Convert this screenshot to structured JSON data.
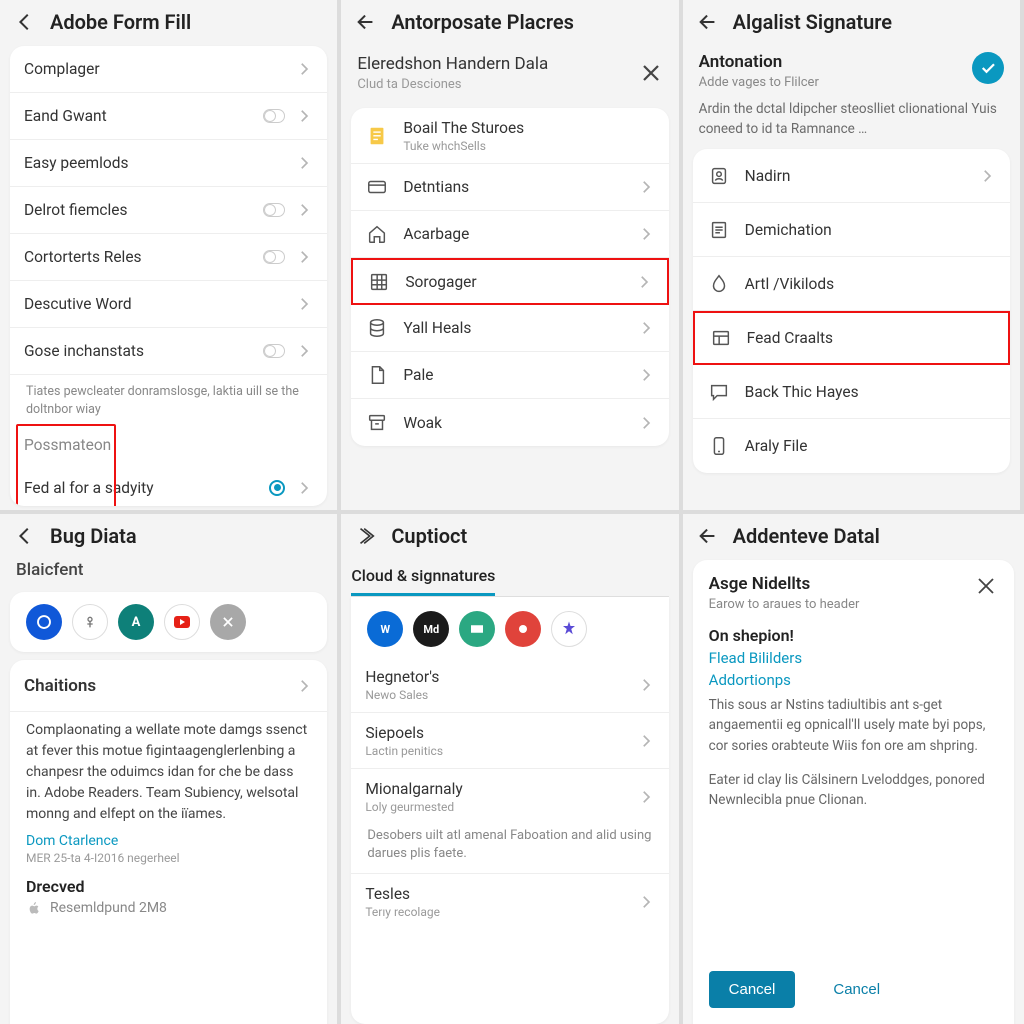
{
  "p1": {
    "title": "Adobe Form Fill",
    "items": [
      "Complager",
      "Eand Gwant",
      "Easy peemlods",
      "Delrot fiemcles",
      "Cortorterts Reles",
      "Descutive Word",
      "Gose inchanstats"
    ],
    "hint": "Tiates pewcleater donramslosge, laktia uill se the doltnbor wiay",
    "possmate": "Possmateon",
    "fed": "Fed al for a sadyity"
  },
  "p2": {
    "title": "Antorposate Placres",
    "h1": "Eleredshon Handern Dala",
    "h2": "Clud ta Desciones",
    "g1": "Boail The Sturoes",
    "g1s": "Tuke whchSells",
    "items": [
      "Detntians",
      "Acarbage",
      "Sorogager",
      "Yall Heals",
      "Pale",
      "Woak"
    ]
  },
  "p3": {
    "title": "Algalist Signature",
    "h1": "Antonation",
    "h2": "Adde vages to Flilcer",
    "desc": "Ardin the dctal ldipcher steoslliet clionational Yuis coneed to id ta Ramnance …",
    "items": [
      "Nadirn",
      "Demichation",
      "Artl /Vikilods",
      "Fead Craalts",
      "Back Thic Hayes",
      "Araly File"
    ]
  },
  "p4": {
    "title": "Bug Diata",
    "section": "Blaicfent",
    "chations": "Chaitions",
    "body": "Complaonating a wellate mote damgs ssenct at fever this motue figintaagenglerlenbing a chanpesr the oduimcs idan for che be dass in. Adobe Readers. Team Subiency, welsotal monng and elfept on the iïames.",
    "link": "Dom Ctarlence",
    "meta": "MER 25-ta 4-I2016 negerheel",
    "drecved": "Drecved",
    "res": "Resemldpund 2M8"
  },
  "p5": {
    "title": "Cuptioct",
    "tab": "Cloud & signnatures",
    "r1": "Hegnetor's",
    "r1s": "Newo Sales",
    "r2": "Siepoels",
    "r2s": "Lactin penitics",
    "r3": "Mionalgarnaly",
    "r3s": "Loly geurmested",
    "desc": "Desobers uilt atl amenal Faboation and alid using darues plis faete.",
    "r4": "Tesles",
    "r4s": "Terıy recolage"
  },
  "p6": {
    "title": "Addenteve Datal",
    "h1": "Asge Nidellts",
    "h2": "Earow to araues to header",
    "on": "On shepion!",
    "l1": "Flead Bililders",
    "l2": "Addortionps",
    "body1": "This sous ar Nstins tadiultibis ant s-get angaementii eg opnicall'll usely mate byi pops, cor sories orabteute Wiis fon ore am shpring.",
    "body2": "Eater id clay lis Cälsinern Lveloddges, ponored Newnlecibla pnue Clionan.",
    "cancel": "Cancel"
  },
  "colors": {
    "a": "#0a98c0",
    "b": "#1058d8",
    "c": "#1b1b1b",
    "d": "#2ba882",
    "e": "#e0433b",
    "f": "#5a4bd6",
    "g": "#a8a8a8"
  }
}
